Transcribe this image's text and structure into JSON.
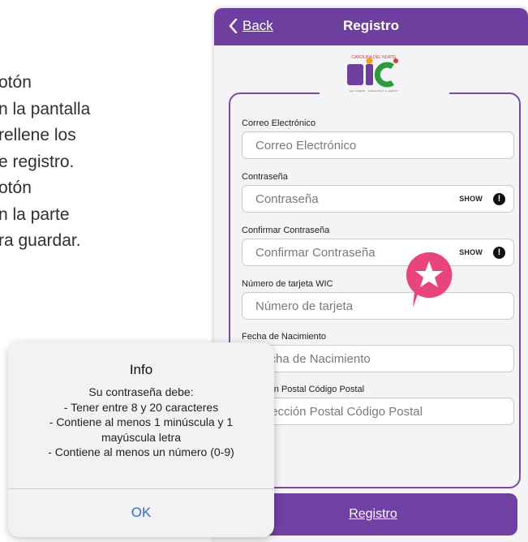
{
  "instructions": {
    "lines": [
      "otón",
      "n la pantalla",
      "rellene los",
      "e registro.",
      "otón",
      "n la parte",
      "ra guardar."
    ]
  },
  "navbar": {
    "back_label": "Back",
    "title": "Registro"
  },
  "logo": {
    "brand_top": "CAROLINA DEL NORTE",
    "brand_main": "WIC",
    "tagline": "MUJERES · INFANTES & NIÑOS"
  },
  "form": {
    "fields": [
      {
        "label": "Correo Electrónico",
        "placeholder": "Correo Electrónico"
      },
      {
        "label": "Contraseña",
        "placeholder": "Contraseña",
        "show": "SHOW"
      },
      {
        "label": "Confirmar Contraseña",
        "placeholder": "Confirmar Contraseña",
        "show": "SHOW"
      },
      {
        "label": "Número de tarjeta WIC",
        "placeholder": "Número de tarjeta"
      },
      {
        "label": "Fecha de Nacimiento",
        "placeholder": "Fecha de Nacimiento"
      },
      {
        "label": "Dirección Postal Código Postal",
        "placeholder": "Dirección Postal Código Postal"
      }
    ],
    "submit_label": "Registro"
  },
  "dialog": {
    "title": "Info",
    "message_lines": [
      "Su contraseña debe:",
      "- Tener entre 8 y 20 caracteres",
      "- Contiene al menos 1 minúscula y 1",
      "mayúscula letra",
      "- Contiene al menos un número (0-9)"
    ],
    "ok_label": "OK"
  },
  "colors": {
    "brand_purple": "#6f3fa0",
    "marker_pink": "#e8457c",
    "link_blue": "#2f6fd7"
  }
}
